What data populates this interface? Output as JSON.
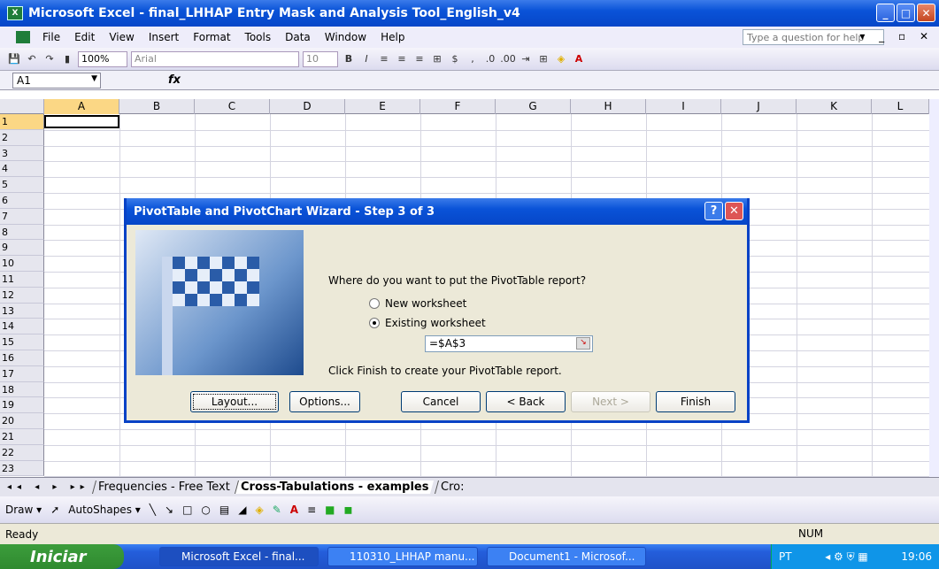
{
  "window": {
    "title": "Microsoft Excel - final_LHHAP Entry Mask and Analysis Tool_English_v4"
  },
  "menu": {
    "items": [
      "File",
      "Edit",
      "View",
      "Insert",
      "Format",
      "Tools",
      "Data",
      "Window",
      "Help"
    ],
    "help_placeholder": "Type a question for help"
  },
  "toolbar": {
    "zoom": "100%",
    "font": "Arial",
    "size": "10"
  },
  "formula": {
    "cell": "A1",
    "fx": "fx"
  },
  "grid": {
    "columns": [
      "A",
      "B",
      "C",
      "D",
      "E",
      "F",
      "G",
      "H",
      "I",
      "J",
      "K",
      "L"
    ],
    "rows": [
      "1",
      "2",
      "3",
      "4",
      "5",
      "6",
      "7",
      "8",
      "9",
      "10",
      "11",
      "12",
      "13",
      "14",
      "15",
      "16",
      "17",
      "18",
      "19",
      "20",
      "21",
      "22",
      "23"
    ]
  },
  "dialog": {
    "title": "PivotTable and PivotChart Wizard - Step 3 of 3",
    "question": "Where do you want to put the PivotTable report?",
    "option_new": "New worksheet",
    "option_existing": "Existing worksheet",
    "reference": "=$A$3",
    "instruction": "Click Finish to create your PivotTable report.",
    "buttons": {
      "layout": "Layout...",
      "options": "Options...",
      "cancel": "Cancel",
      "back": "< Back",
      "next": "Next >",
      "finish": "Finish"
    }
  },
  "sheets": {
    "tabs": [
      "Frequencies - Free Text",
      "Cross-Tabulations - examples",
      "Cro:"
    ]
  },
  "drawbar": {
    "draw": "Draw ▾",
    "autoshapes": "AutoShapes ▾"
  },
  "status": {
    "ready": "Ready",
    "num": "NUM"
  },
  "taskbar": {
    "start": "Iniciar",
    "tasks": [
      "Microsoft Excel - final...",
      "110310_LHHAP manu...",
      "Document1 - Microsof..."
    ],
    "lang": "PT",
    "time": "19:06"
  }
}
